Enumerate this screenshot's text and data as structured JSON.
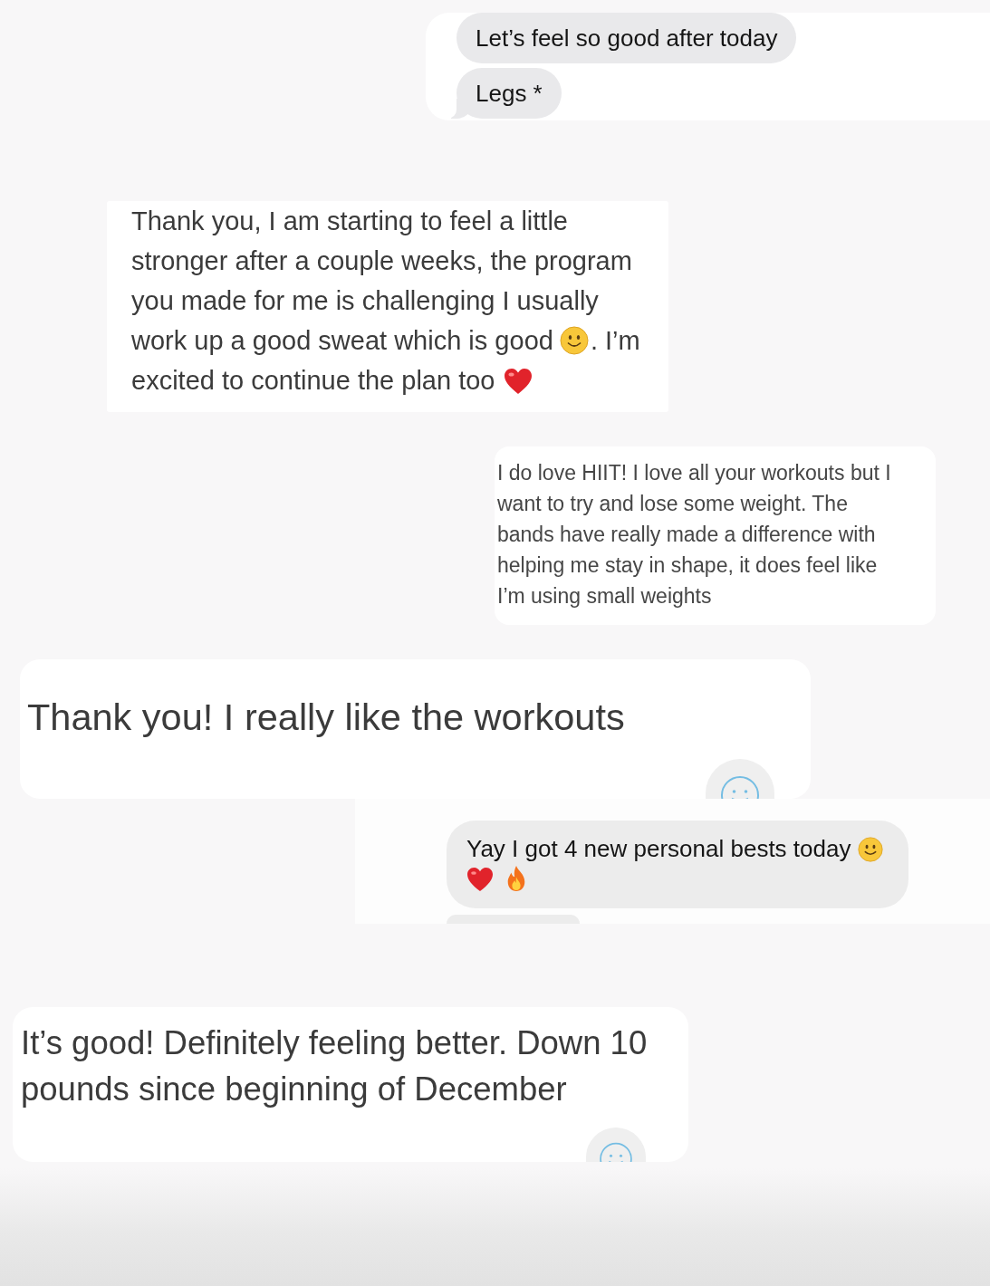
{
  "snippets": [
    {
      "kind": "bubble_group",
      "bubbles": [
        {
          "kind": "full",
          "parts": [
            {
              "kind": "text",
              "text": "Let’s feel so good after today"
            }
          ],
          "tail": false
        },
        {
          "kind": "full",
          "parts": [
            {
              "kind": "text",
              "text": "Legs *"
            }
          ],
          "tail": true
        }
      ]
    },
    {
      "kind": "card",
      "parts": [
        {
          "kind": "text",
          "text": "Thank you, I am starting to feel a little stronger after a couple weeks, the program you made for me is challenging I usually work up a good sweat which is good"
        },
        {
          "kind": "smile"
        },
        {
          "kind": "text",
          "text": ". I’m excited to continue the plan too"
        },
        {
          "kind": "heart"
        }
      ],
      "reaction_button": false
    },
    {
      "kind": "card",
      "parts": [
        {
          "kind": "text",
          "text": "I do love HIIT! I love all your workouts but I want to try and lose some weight. The bands have really made a difference with helping me stay in shape, it does feel like I’m using small weights"
        }
      ],
      "reaction_button": false
    },
    {
      "kind": "card",
      "parts": [
        {
          "kind": "text",
          "text": "Thank you! I really like the workouts"
        }
      ],
      "reaction_button": true
    },
    {
      "kind": "bubble_group",
      "bubbles": [
        {
          "kind": "full",
          "parts": [
            {
              "kind": "text",
              "text": "Yay I got 4 new personal bests today"
            },
            {
              "kind": "smile"
            },
            {
              "kind": "heart"
            },
            {
              "kind": "fire"
            }
          ],
          "tail": false
        },
        {
          "kind": "cut_off",
          "tail": false
        }
      ]
    },
    {
      "kind": "card",
      "parts": [
        {
          "kind": "text",
          "text": "It’s good! Definitely feeling better. Down 10 pounds since beginning of December"
        }
      ],
      "reaction_button": true
    }
  ]
}
